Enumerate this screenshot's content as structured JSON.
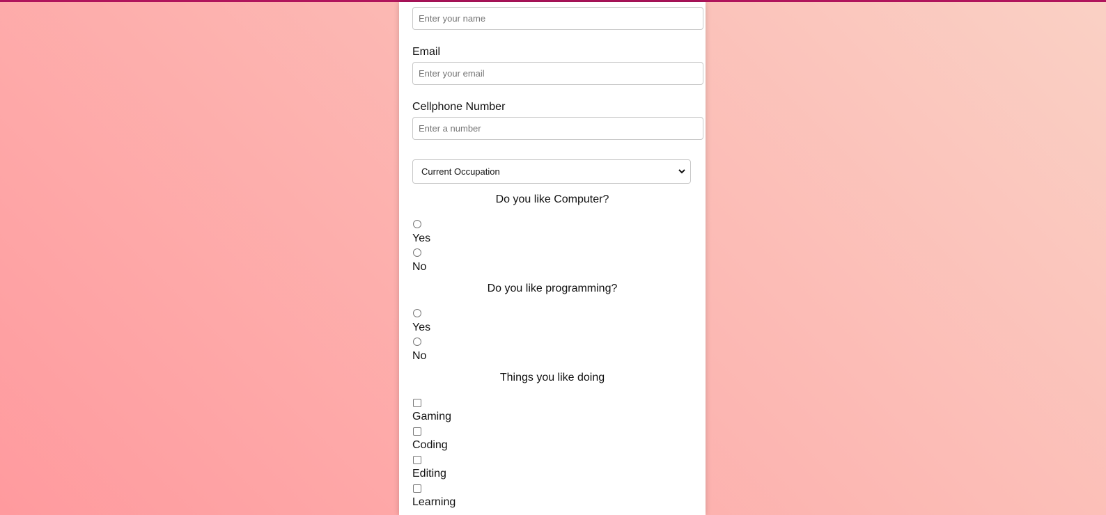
{
  "form": {
    "name_field": {
      "placeholder": "Enter your name",
      "value": ""
    },
    "email_field": {
      "label": "Email",
      "placeholder": "Enter your email",
      "value": ""
    },
    "phone_field": {
      "label": "Cellphone Number",
      "placeholder": "Enter a number",
      "value": ""
    },
    "occupation_select": {
      "selected": "Current Occupation"
    },
    "question_computer": {
      "text": "Do you like Computer?",
      "options": [
        {
          "label": "Yes",
          "checked": false
        },
        {
          "label": "No",
          "checked": false
        }
      ]
    },
    "question_programming": {
      "text": "Do you like programming?",
      "options": [
        {
          "label": "Yes",
          "checked": false
        },
        {
          "label": "No",
          "checked": false
        }
      ]
    },
    "things_you_like": {
      "text": "Things you like doing",
      "options": [
        {
          "label": "Gaming",
          "checked": false
        },
        {
          "label": "Coding",
          "checked": false
        },
        {
          "label": "Editing",
          "checked": false
        },
        {
          "label": "Learning",
          "checked": false
        }
      ]
    }
  },
  "colors": {
    "top_bar": "#b0145c",
    "background_gradient_start": "#ff9a9e",
    "background_gradient_end": "#fad0c4",
    "panel": "#ffffff"
  },
  "icons": {
    "select_arrow": "chevron-down-icon"
  }
}
